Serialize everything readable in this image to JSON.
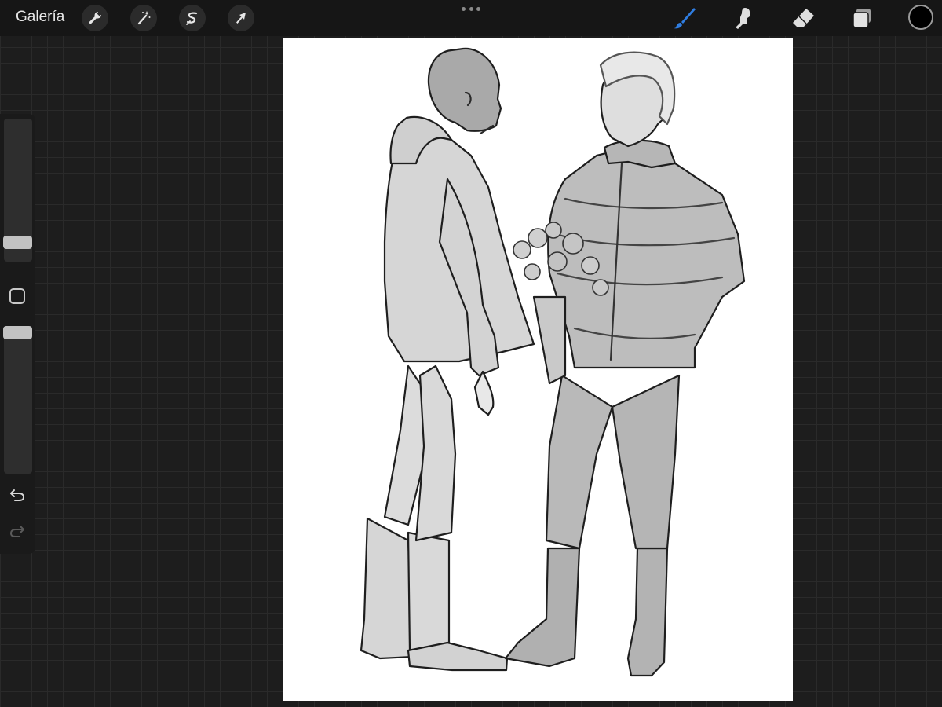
{
  "topbar": {
    "gallery_label": "Galería",
    "left_tools": [
      "wrench-icon",
      "magic-wand-icon",
      "selection-icon",
      "transform-arrow-icon"
    ],
    "right_tools": [
      "brush-icon",
      "smudge-icon",
      "eraser-icon",
      "layers-icon"
    ],
    "active_tool": "brush-icon",
    "active_color": "#000000",
    "accent_color": "#2f7de1"
  },
  "sidebar": {
    "brush_size_level": 0.1,
    "opacity_level": 1.0,
    "buttons": [
      "modify-square-icon",
      "undo-icon",
      "redo-icon"
    ]
  },
  "canvas": {
    "background": "#ffffff",
    "content": "sketch"
  }
}
